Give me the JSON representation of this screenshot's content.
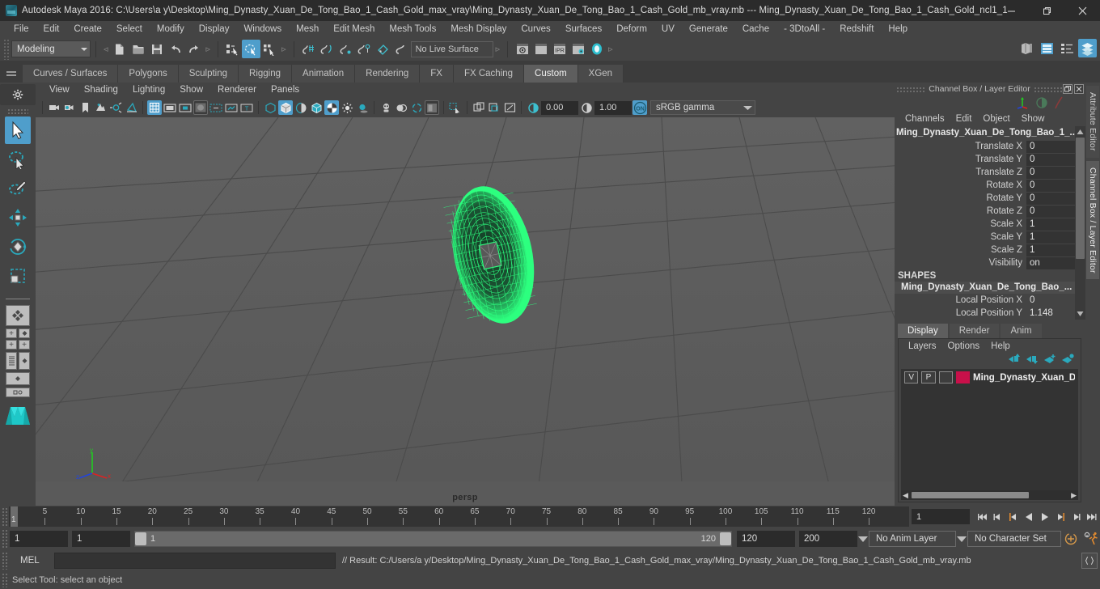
{
  "window": {
    "title": "Autodesk Maya 2016: C:\\Users\\a y\\Desktop\\Ming_Dynasty_Xuan_De_Tong_Bao_1_Cash_Gold_max_vray\\Ming_Dynasty_Xuan_De_Tong_Bao_1_Cash_Gold_mb_vray.mb  ---  Ming_Dynasty_Xuan_De_Tong_Bao_1_Cash_Gold_ncl1_1",
    "app_icon": "maya-icon",
    "minimize": "minimize-icon",
    "maximize": "restore-icon",
    "close": "close-icon"
  },
  "menubar": {
    "items": [
      "File",
      "Edit",
      "Create",
      "Select",
      "Modify",
      "Display",
      "Windows",
      "Mesh",
      "Edit Mesh",
      "Mesh Tools",
      "Mesh Display",
      "Curves",
      "Surfaces",
      "Deform",
      "UV",
      "Generate",
      "Cache",
      "- 3DtoAll -",
      "Redshift",
      "Help"
    ]
  },
  "toolbar": {
    "menuset": "Modeling",
    "file_icons": [
      "new-scene-icon",
      "open-scene-icon",
      "save-scene-icon",
      "undo-icon",
      "redo-icon"
    ],
    "select_icons": [
      "select-by-hierarchy-icon",
      "select-by-object-type-icon",
      "select-by-component-type-icon"
    ],
    "snap_icons": [
      "snap-to-grid-icon",
      "snap-to-curve-icon",
      "snap-to-point-icon",
      "snap-to-projected-center-icon",
      "snap-to-view-plane-icon",
      "make-live-icon"
    ],
    "live_surface": "No Live Surface",
    "render_icons": [
      "render-current-frame-icon",
      "render-sequence-icon",
      "ipr-render-icon",
      "render-settings-icon",
      "hypershade-icon"
    ],
    "right_icons": [
      "show-hide-modeling-toolkit-icon",
      "show-hide-attribute-editor-icon",
      "show-hide-tool-settings-icon",
      "show-hide-channel-box-icon"
    ]
  },
  "shelf": {
    "grip": "shelf-grip-icon",
    "tabs": [
      "Curves / Surfaces",
      "Polygons",
      "Sculpting",
      "Rigging",
      "Animation",
      "Rendering",
      "FX",
      "FX Caching",
      "Custom",
      "XGen"
    ],
    "active_tab": "Custom"
  },
  "toolbox": {
    "tools": [
      {
        "name": "select-tool-icon",
        "active": true
      },
      {
        "name": "lasso-select-tool-icon",
        "active": false
      },
      {
        "name": "paint-select-tool-icon",
        "active": false
      },
      {
        "name": "move-tool-icon",
        "active": false
      },
      {
        "name": "rotate-tool-icon",
        "active": false
      },
      {
        "name": "scale-tool-icon",
        "active": false
      }
    ],
    "layout_presets": [
      "single-perspective-view-icon",
      "four-view-layout-icon",
      "outliner-persp-layout-icon",
      "persp-graph-layout-icon",
      "hypershade-persp-layout-icon"
    ]
  },
  "viewport": {
    "menus": [
      "View",
      "Shading",
      "Lighting",
      "Show",
      "Renderer",
      "Panels"
    ],
    "toolbar_icons": [
      "select-camera-icon",
      "camera-attributes-icon",
      "bookmark-icon",
      "image-plane-icon",
      "two-sided-lighting-icon",
      "shadows-icon",
      "grid-toggle-icon",
      "film-gate-icon",
      "resolution-gate-icon",
      "gate-mask-icon",
      "film-origin-icon",
      "safe-action-icon",
      "safe-title-icon",
      "wireframe-icon",
      "smooth-shade-all-icon",
      "smooth-shade-selected-icon",
      "shaded-wireframe-icon",
      "textured-icon",
      "use-all-lights-icon",
      "shadows-toggle-icon",
      "x-ray-icon",
      "x-ray-joints-icon",
      "x-ray-active-components-icon",
      "exposure-icon",
      "isolate-select-icon",
      "display-mask-icon",
      "panel-zoom-icon",
      "render-region-icon"
    ],
    "exposure_value": "0.00",
    "gamma_value": "1.00",
    "color_management_toggle": "ON",
    "color_profile": "sRGB gamma",
    "camera_label": "persp",
    "axis_labels": {
      "x": "x",
      "y": "y",
      "z": "z"
    },
    "grid_color": "#5a5a5a",
    "selection_color": "#2dff7f",
    "object_name": "Ming Dynasty Xuan De Tong Bao cash coin wireframe"
  },
  "channel_box": {
    "panel_title": "Channel Box / Layer Editor",
    "panel_buttons": [
      "undock-icon",
      "close-panel-icon"
    ],
    "header_icons": [
      "axis-orientation-icon",
      "shading-preview-icon",
      "highlight-icon"
    ],
    "menus": [
      "Channels",
      "Edit",
      "Object",
      "Show"
    ],
    "object_name": "Ming_Dynasty_Xuan_De_Tong_Bao_1_...",
    "transform_attrs": [
      {
        "label": "Translate X",
        "value": "0"
      },
      {
        "label": "Translate Y",
        "value": "0"
      },
      {
        "label": "Translate Z",
        "value": "0"
      },
      {
        "label": "Rotate X",
        "value": "0"
      },
      {
        "label": "Rotate Y",
        "value": "0"
      },
      {
        "label": "Rotate Z",
        "value": "0"
      },
      {
        "label": "Scale X",
        "value": "1"
      },
      {
        "label": "Scale Y",
        "value": "1"
      },
      {
        "label": "Scale Z",
        "value": "1"
      },
      {
        "label": "Visibility",
        "value": "on"
      }
    ],
    "shapes_header": "SHAPES",
    "shape_name": "Ming_Dynasty_Xuan_De_Tong_Bao_...",
    "shape_attrs": [
      {
        "label": "Local Position X",
        "value": "0"
      },
      {
        "label": "Local Position Y",
        "value": "1.148"
      }
    ]
  },
  "layer_editor": {
    "tabs": [
      "Display",
      "Render",
      "Anim"
    ],
    "active_tab": "Display",
    "menus": [
      "Layers",
      "Options",
      "Help"
    ],
    "toolbar_icons": [
      "move-layer-up-icon",
      "move-layer-down-icon",
      "new-layer-icon",
      "new-layer-from-selected-icon"
    ],
    "layers": [
      {
        "visibility": "V",
        "playback": "P",
        "shading": "",
        "color": "#c8104a",
        "name": "Ming_Dynasty_Xuan_De_"
      }
    ],
    "scroll_left": "scroll-left-arrow-icon",
    "scroll_right": "scroll-right-arrow-icon"
  },
  "side_tabs": [
    "Attribute Editor",
    "Channel Box / Layer Editor"
  ],
  "timeline": {
    "start": 1,
    "end": 120,
    "tick_labels": [
      5,
      10,
      15,
      20,
      25,
      30,
      35,
      40,
      45,
      50,
      55,
      60,
      65,
      70,
      75,
      80,
      85,
      90,
      95,
      100,
      105,
      110,
      115,
      120
    ],
    "current_frame": "1",
    "current_frame_field": "1",
    "playback_buttons": [
      "go-to-start-icon",
      "step-back-keyframe-icon",
      "step-back-frame-icon",
      "play-backwards-icon",
      "play-forwards-icon",
      "step-forward-frame-icon",
      "step-forward-keyframe-icon",
      "go-to-end-icon"
    ]
  },
  "range_slider": {
    "anim_start": "1",
    "range_start": "1",
    "slider_min_label": "1",
    "slider_max_label": "120",
    "range_end": "120",
    "anim_end": "200",
    "anim_layer": "No Anim Layer",
    "character_set": "No Character Set",
    "auto_keyframe_icon": "auto-keyframe-icon",
    "animation_prefs_icon": "animation-preferences-icon"
  },
  "command_line": {
    "language_label": "MEL",
    "input_value": "",
    "result_text": "// Result: C:/Users/a y/Desktop/Ming_Dynasty_Xuan_De_Tong_Bao_1_Cash_Gold_max_vray/Ming_Dynasty_Xuan_De_Tong_Bao_1_Cash_Gold_mb_vray.mb",
    "script_editor_icon": "script-editor-icon"
  },
  "help_line": {
    "text": "Select Tool: select an object"
  }
}
